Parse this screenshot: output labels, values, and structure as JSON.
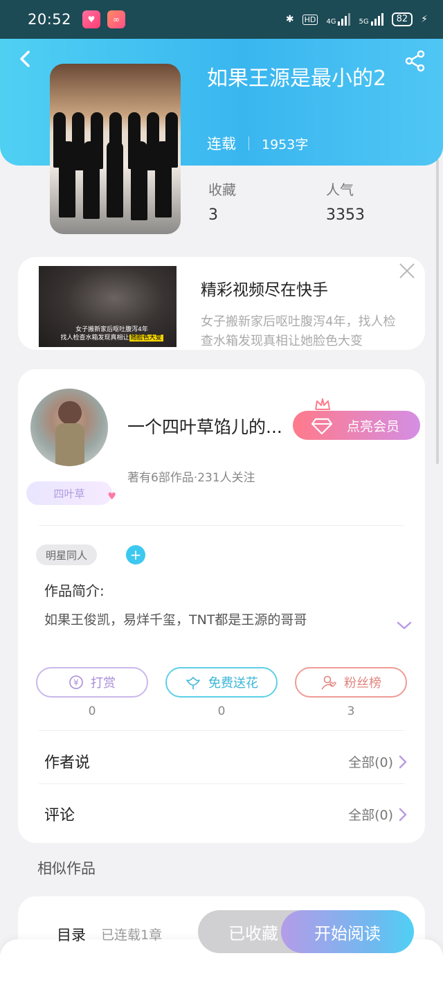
{
  "status_bar": {
    "time": "20:52",
    "hd_label": "HD",
    "net1_label": "4G",
    "net2_label": "5G",
    "battery": "82"
  },
  "book": {
    "title": "如果王源是最小的2",
    "status": "连载",
    "word_count": "1953字",
    "stats": [
      {
        "label": "收藏",
        "value": "3"
      },
      {
        "label": "人气",
        "value": "3353"
      }
    ]
  },
  "ad": {
    "title": "精彩视频尽在快手",
    "description_line1": "女子搬新家后呕吐腹泻4年，找人检",
    "description_line2": "查水箱发现真相让她脸色大变",
    "thumb_caption_line1": "女子搬新家后呕吐腹泻4年",
    "thumb_caption_line2_a": "找人检查水箱发现真相让",
    "thumb_caption_line2_b": "她脸色大变"
  },
  "author": {
    "name": "一个四叶草馅儿的...",
    "badge": "四叶草",
    "info": "著有6部作品·231人关注",
    "vip_button": "点亮会员"
  },
  "tags": [
    "明星同人"
  ],
  "intro": {
    "label": "作品简介:",
    "text": "如果王俊凯，易烊千玺，TNT都是王源的哥哥"
  },
  "actions": [
    {
      "label": "打赏",
      "count": "0",
      "icon": "yen-coin-icon"
    },
    {
      "label": "免费送花",
      "count": "0",
      "icon": "flower-icon"
    },
    {
      "label": "粉丝榜",
      "count": "3",
      "icon": "fans-icon"
    }
  ],
  "rows": [
    {
      "label": "作者说",
      "value": "全部(0)"
    },
    {
      "label": "评论",
      "value": "全部(0)"
    }
  ],
  "similar_title": "相似作品",
  "bottom_bar": {
    "toc": "目录",
    "serial": "已连载1章",
    "favorite": "已收藏",
    "read": "开始阅读"
  },
  "colors": {
    "header_gradient_start": "#4fd0f3",
    "header_gradient_end": "#3ab6ef",
    "vip_start": "#ff7a8a",
    "vip_end": "#d48ee4"
  }
}
